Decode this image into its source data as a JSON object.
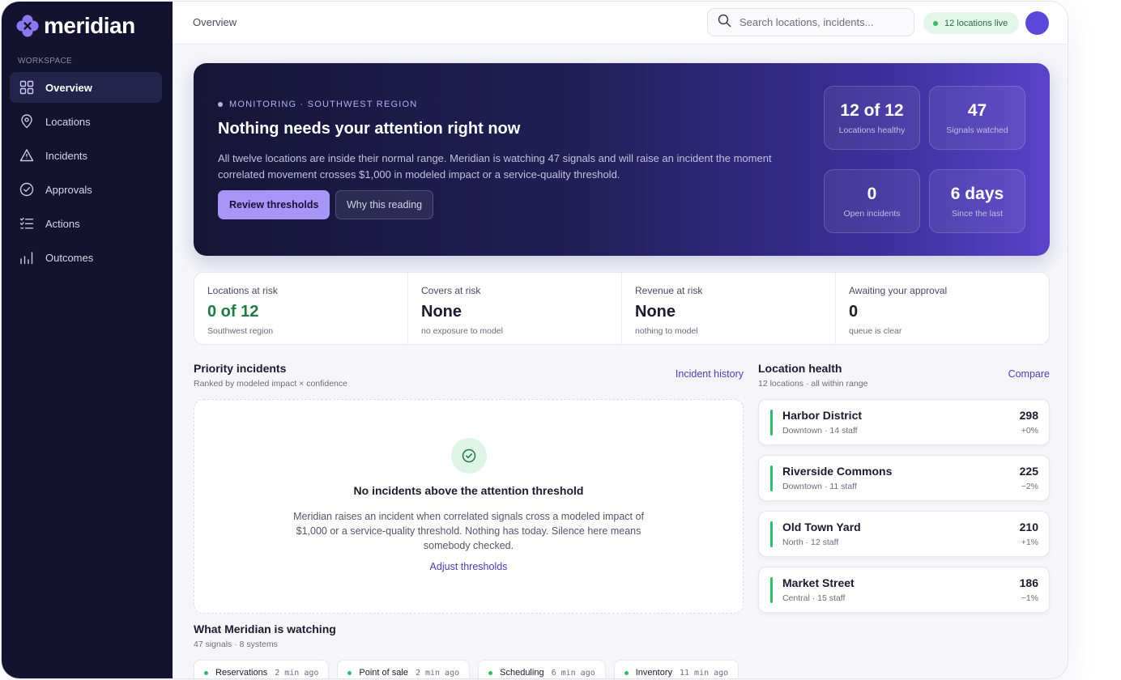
{
  "app": {
    "name": "meridian"
  },
  "sidebar": {
    "section_label": "WORKSPACE",
    "items": [
      {
        "label": "Overview",
        "icon": "grid-icon",
        "active": true
      },
      {
        "label": "Locations",
        "icon": "map-pin-icon"
      },
      {
        "label": "Incidents",
        "icon": "warning-triangle-icon"
      },
      {
        "label": "Approvals",
        "icon": "check-circle-icon"
      },
      {
        "label": "Actions",
        "icon": "checklist-icon"
      },
      {
        "label": "Outcomes",
        "icon": "bar-chart-icon"
      }
    ]
  },
  "topbar": {
    "breadcrumb": "Overview",
    "search_placeholder": "Search locations, incidents...",
    "live_status": "12 locations live"
  },
  "hero": {
    "eyebrow": "MONITORING · SOUTHWEST REGION",
    "title": "Nothing needs your attention right now",
    "description": "All twelve locations are inside their normal range. Meridian is watching 47 signals and will raise an incident the moment correlated movement crosses $1,000 in modeled impact or a service-quality threshold.",
    "primary_button": "Review thresholds",
    "secondary_button": "Why this reading",
    "stats": [
      {
        "value": "12 of 12",
        "label": "Locations healthy"
      },
      {
        "value": "47",
        "label": "Signals watched"
      },
      {
        "value": "0",
        "label": "Open incidents"
      },
      {
        "value": "6 days",
        "label": "Since the last"
      }
    ]
  },
  "kpis": [
    {
      "label": "Locations at risk",
      "value": "0 of 12",
      "sub": "Southwest region"
    },
    {
      "label": "Covers at risk",
      "value": "None",
      "sub": "no exposure to model"
    },
    {
      "label": "Revenue at risk",
      "value": "None",
      "sub": "nothing to model"
    },
    {
      "label": "Awaiting your approval",
      "value": "0",
      "sub": "queue is clear"
    }
  ],
  "priority": {
    "title": "Priority incidents",
    "subtitle": "Ranked by modeled impact × confidence",
    "link": "Incident history",
    "empty_title": "No incidents above the attention threshold",
    "empty_desc": "Meridian raises an incident when correlated signals cross a modeled impact of $1,000 or a service-quality threshold. Nothing has today. Silence here means somebody checked.",
    "empty_link": "Adjust thresholds"
  },
  "health": {
    "title": "Location health",
    "subtitle": "12 locations · all within range",
    "link": "Compare",
    "locations": [
      {
        "name": "Harbor District",
        "meta": "Downtown · 14 staff",
        "value": "298",
        "delta": "+0%"
      },
      {
        "name": "Riverside Commons",
        "meta": "Downtown · 11 staff",
        "value": "225",
        "delta": "−2%"
      },
      {
        "name": "Old Town Yard",
        "meta": "North · 12 staff",
        "value": "210",
        "delta": "+1%"
      },
      {
        "name": "Market Street",
        "meta": "Central · 15 staff",
        "value": "186",
        "delta": "−1%"
      }
    ]
  },
  "watching": {
    "title": "What Meridian is watching",
    "subtitle": "47 signals · 8 systems",
    "signals": [
      {
        "name": "Reservations",
        "time": "2 min ago"
      },
      {
        "name": "Point of sale",
        "time": "2 min ago"
      },
      {
        "name": "Scheduling",
        "time": "6 min ago"
      },
      {
        "name": "Inventory",
        "time": "11 min ago"
      }
    ]
  },
  "colors": {
    "accent": "#a796f6",
    "sidebar_bg": "#131330",
    "healthy": "#2fbf6b",
    "link": "#4a3fb5"
  }
}
